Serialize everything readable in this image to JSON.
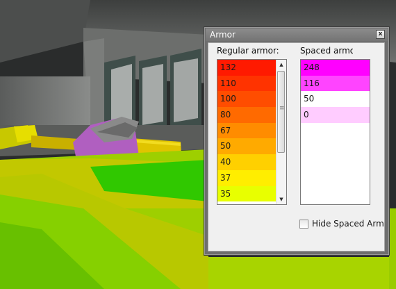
{
  "window": {
    "title": "Armor",
    "close_glyph": "x"
  },
  "regular": {
    "label": "Regular armor:",
    "rows": [
      {
        "value": "132",
        "color": "#ff1a00"
      },
      {
        "value": "110",
        "color": "#ff3300"
      },
      {
        "value": "100",
        "color": "#ff4d00"
      },
      {
        "value": "80",
        "color": "#ff6a00"
      },
      {
        "value": "67",
        "color": "#ff8c00"
      },
      {
        "value": "50",
        "color": "#ffaa00"
      },
      {
        "value": "40",
        "color": "#ffd000"
      },
      {
        "value": "37",
        "color": "#ffee00"
      },
      {
        "value": "35",
        "color": "#e8ff00"
      }
    ],
    "scroll_up_glyph": "▲",
    "scroll_down_glyph": "▼"
  },
  "spaced": {
    "label": "Spaced armo",
    "rows": [
      {
        "value": "248",
        "color": "#ff00ff"
      },
      {
        "value": "116",
        "color": "#ff44ff"
      },
      {
        "value": "50",
        "color": "#ffffff"
      },
      {
        "value": "0",
        "color": "#ffccff"
      }
    ]
  },
  "hide_spaced": {
    "label": "Hide Spaced Armo",
    "checked": false
  }
}
